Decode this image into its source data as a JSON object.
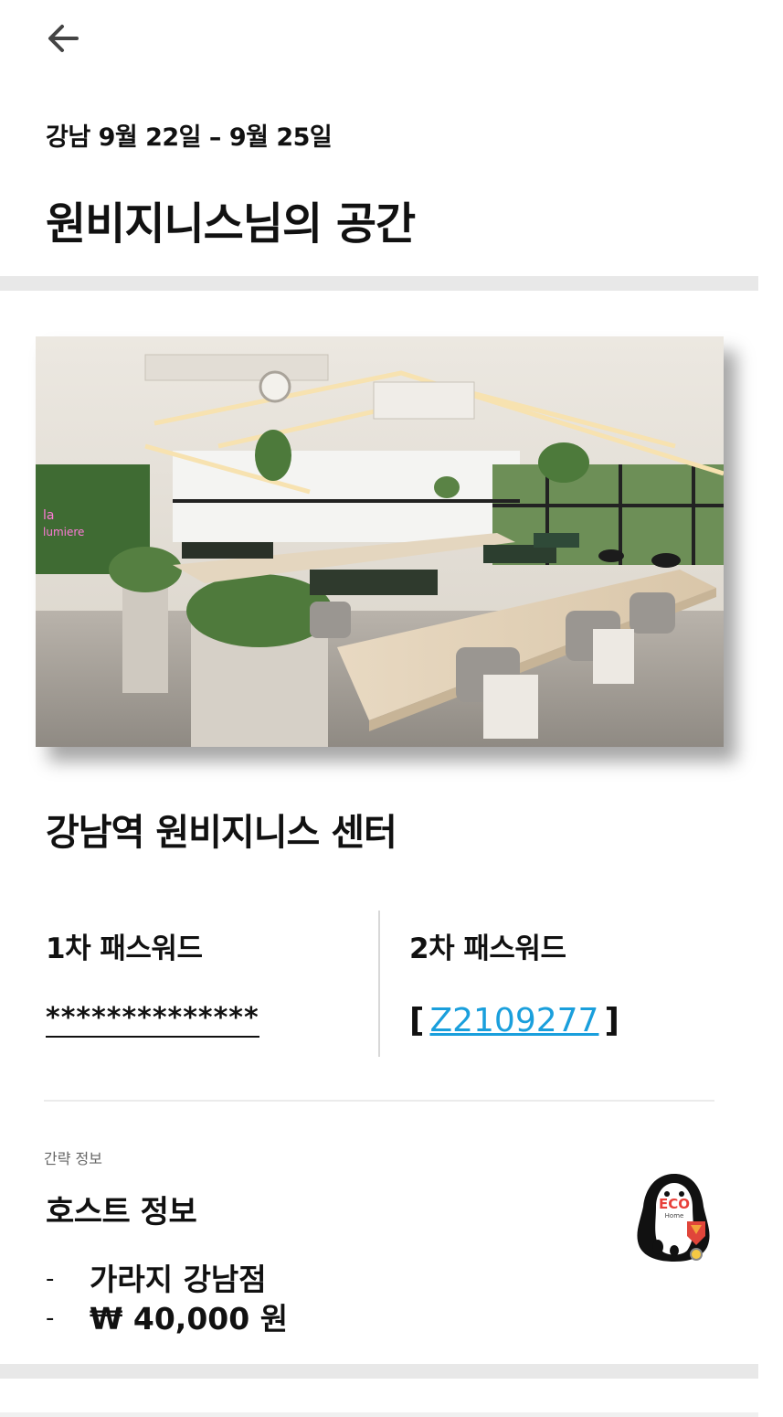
{
  "header": {
    "back_icon": "arrow-left-icon",
    "subtitle": "강남 9월 22일 – 9월 25일",
    "title": "원비지니스님의 공간"
  },
  "space": {
    "photo_icon": "office-photo",
    "name": "강남역 원비지니스 센터"
  },
  "passwords": {
    "first_label": "1차 패스워드",
    "first_value": "**************",
    "second_label": "2차 패스워드",
    "second_open": "[",
    "second_value": "Z2109277",
    "second_close": "]",
    "link_color": "#1a9fdc"
  },
  "host": {
    "brief_label": "간략 정보",
    "title": "호스트 정보",
    "items": [
      {
        "bullet": "-",
        "text": "가라지 강남점"
      },
      {
        "bullet": "-",
        "text": "₩ 40,000 원"
      }
    ],
    "logo_text": "ECO",
    "logo_subtext": "Home"
  }
}
